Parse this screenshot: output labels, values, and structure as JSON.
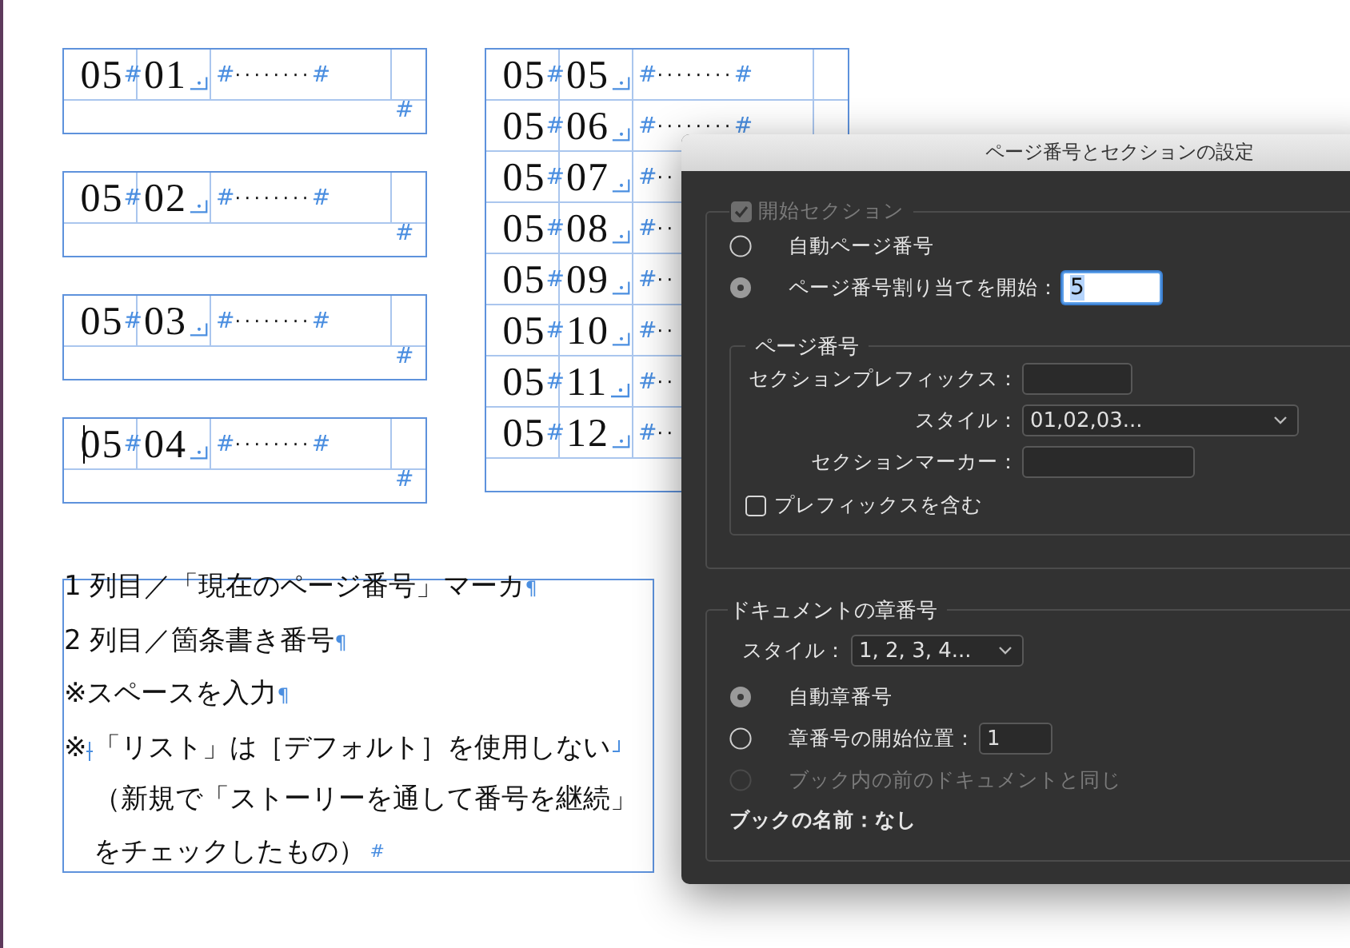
{
  "frames": [
    {
      "rows": [
        {
          "marker": "05",
          "number": "01",
          "cell_end": "#",
          "leader_start": "#",
          "leader": "········",
          "leader_end": "#",
          "row_end": "#",
          "cursor": false
        }
      ]
    },
    {
      "rows": [
        {
          "marker": "05",
          "number": "02",
          "cell_end": "#",
          "leader_start": "#",
          "leader": "········",
          "leader_end": "#",
          "row_end": "#",
          "cursor": false
        }
      ]
    },
    {
      "rows": [
        {
          "marker": "05",
          "number": "03",
          "cell_end": "#",
          "leader_start": "#",
          "leader": "········",
          "leader_end": "#",
          "row_end": "#",
          "cursor": false
        }
      ]
    },
    {
      "rows": [
        {
          "marker": "05",
          "number": "04",
          "cell_end": "#",
          "leader_start": "#",
          "leader": "········",
          "leader_end": "#",
          "row_end": "#",
          "cursor": true
        }
      ]
    },
    {
      "rows": [
        {
          "marker": "05",
          "number": "05",
          "cell_end": "#",
          "leader_start": "#",
          "leader": "········",
          "leader_end": "#",
          "cursor": false
        },
        {
          "marker": "05",
          "number": "06",
          "cell_end": "#",
          "leader_start": "#",
          "leader": "········",
          "leader_end": "#",
          "cursor": false
        },
        {
          "marker": "05",
          "number": "07",
          "cell_end": "#",
          "leader_start": "#",
          "leader": "··",
          "cursor": false
        },
        {
          "marker": "05",
          "number": "08",
          "cell_end": "#",
          "leader_start": "#",
          "leader": "··",
          "cursor": false
        },
        {
          "marker": "05",
          "number": "09",
          "cell_end": "#",
          "leader_start": "#",
          "leader": "··",
          "cursor": false
        },
        {
          "marker": "05",
          "number": "10",
          "cell_end": "#",
          "leader_start": "#",
          "leader": "··",
          "cursor": false
        },
        {
          "marker": "05",
          "number": "11",
          "cell_end": "#",
          "leader_start": "#",
          "leader": "··",
          "cursor": false
        },
        {
          "marker": "05",
          "number": "12",
          "cell_end": "#",
          "leader_start": "#",
          "leader": "··",
          "cursor": false
        }
      ]
    }
  ],
  "note_frame": {
    "paragraphs": [
      {
        "kind": "plain",
        "text": "1 列目／「現在のページ番号」マーカ",
        "end": "¶"
      },
      {
        "kind": "plain",
        "text": "2 列目／箇条書き番号",
        "end": "¶"
      },
      {
        "kind": "plain",
        "text": "※スペースを入力",
        "end": "¶"
      },
      {
        "kind": "hanging",
        "bullet": "※",
        "lines": [
          "「リスト」は［デフォルト］を使用しない",
          "（新規で「ストーリーを通して番号を継続」",
          "をチェックしたもの）"
        ],
        "end": "#"
      }
    ]
  },
  "dialog": {
    "title": "ページ番号とセクションの設定",
    "start_section": {
      "label": "開始セクション",
      "checked": true,
      "disabled": true,
      "options": [
        {
          "label": "自動ページ番号",
          "selected": false
        },
        {
          "label": "ページ番号割り当てを開始：",
          "selected": true,
          "value": "5"
        }
      ],
      "page_numbering": {
        "title": "ページ番号",
        "fields": [
          {
            "kind": "text",
            "label": "セクションプレフィックス："
          },
          {
            "kind": "select",
            "label": "スタイル：",
            "value": "01,02,03..."
          },
          {
            "kind": "text",
            "label": "セクションマーカー："
          }
        ],
        "include_prefix": {
          "label": "プレフィックスを含む",
          "checked": false
        }
      }
    },
    "chapter": {
      "title": "ドキュメントの章番号",
      "style_label": "スタイル：",
      "style_value": "1, 2, 3, 4...",
      "options": [
        {
          "label": "自動章番号",
          "selected": true,
          "disabled": false
        },
        {
          "label": "章番号の開始位置：",
          "value": "1",
          "selected": false,
          "disabled": false
        },
        {
          "label": "ブック内の前のドキュメントと同じ",
          "selected": false,
          "disabled": true
        }
      ],
      "book_name": "ブックの名前：なし"
    }
  }
}
